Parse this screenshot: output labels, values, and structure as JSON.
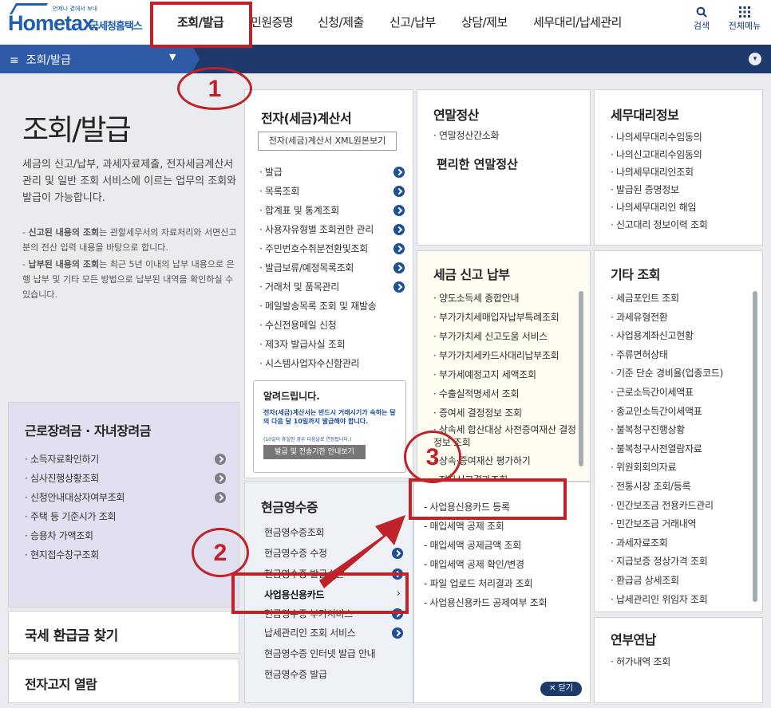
{
  "header": {
    "logo_text": "Hometax.",
    "logo_tagline": "국세청홈택스",
    "logo_small": "언제나 곁에서 보내",
    "nav": [
      "조회/발급",
      "민원증명",
      "신청/제출",
      "신고/납부",
      "상담/제보",
      "세무대리/납세관리"
    ],
    "search_label": "검색",
    "all_menu_label": "전체메뉴"
  },
  "subbar": {
    "menu_icon": "≡",
    "current": "조회/발급",
    "caret": "▼",
    "circle_icon": "▾"
  },
  "intro": {
    "title": "조회/발급",
    "description": "세금의 신고/납부, 과세자료제출, 전자세금계산서 관리 및 일반 조회 서비스에 이르는 업무의 조회와 발급이 가능합니다.",
    "note1_bold": "신고된 내용의 조회",
    "note1_rest": "는 관할세무서의 자료처리와 서면신고분의 전산 입력 내용을 바탕으로 합니다.",
    "note2_bold": "납부된 내용의 조회",
    "note2_rest": "는 최근 5년 이내의 납부 내용으로 은행 납부 및 기타 모든 방법으로 납부된 내역을 확인하실 수 있습니다."
  },
  "einvoice": {
    "title": "전자(세금)계산서",
    "xml_button": "전자(세금)계산서 XML원본보기",
    "items": [
      "발급",
      "목록조회",
      "합계표 및 통계조회",
      "사용자유형별 조회권한 관리",
      "주민번호수취분전환및조회",
      "발급보류/예정목록조회",
      "거래처 및 품목관리",
      "메일발송목록 조회 및 재발송",
      "수신전용메일 신청",
      "제3자 발급사실 조회",
      "시스템사업자수신함관리"
    ],
    "notice_title": "알려드립니다.",
    "notice_text": "전자(세금)계산서는 반드시 거래시기가 속하는 달의 다음 달 10일까지 발급해야 합니다.",
    "notice_small": "(10일이 휴일인 경우 다음날로 연장됩니다.)",
    "notice_button": "발급 및 전송기한 안내보기"
  },
  "yearend": {
    "title": "연말정산",
    "item": "연말정산간소화",
    "sub": "편리한 연말정산"
  },
  "agent": {
    "title": "세무대리정보",
    "items": [
      "나의세무대리수임동의",
      "나의신고대리수임동의",
      "나의세무대리인조회",
      "발급된 증명정보",
      "나의세무대리인 해임",
      "신고대리 정보이력 조회"
    ]
  },
  "tax_report": {
    "title": "세금 신고 납부",
    "items": [
      "양도소득세 종합안내",
      "부가가치세매입자납부특례조회",
      "부가가치세 신고도움 서비스",
      "부가가치세카드사대리납부조회",
      "부가세예정고지 세액조회",
      "수출실적명세서 조회",
      "증여세 결정정보 조회",
      "상속세 합산대상 사전증여재산 결정정보 조회",
      "상속·증여재산 평가하기",
      "전자신고결과조회"
    ]
  },
  "other": {
    "title": "기타 조회",
    "items": [
      "세금포인트 조회",
      "과세유형전환",
      "사업용계좌신고현황",
      "주류면허상태",
      "기준 단순 경비율(업종코드)",
      "근로소득간이세액표",
      "종교인소득간이세액표",
      "불복청구진행상황",
      "불복청구사전열람자료",
      "위원회회의자료",
      "전통시장 조회/등록",
      "민간보조금 전용카드관리",
      "민간보조금 거래내역",
      "과세자료조회",
      "지급보증 정상가격 조회",
      "환급금 상세조회",
      "납세관리인 위임자 조회"
    ]
  },
  "earned": {
    "title": "근로장려금 · 자녀장려금",
    "items": [
      "소득자료확인하기",
      "심사진행상황조회",
      "신청안내대상자여부조회",
      "주택 등 기준시가 조회",
      "승용차 가액조회",
      "현지접수창구조회"
    ]
  },
  "cash": {
    "title": "현금영수증",
    "items": [
      "현금영수증조회",
      "현금영수증 수정",
      "현금영수증 발급수단",
      "사업용신용카드",
      "현금영수증 부가서비스",
      "납세관리인 조회 서비스",
      "현금영수증 인터넷 발급 안내",
      "현금영수증 발급"
    ]
  },
  "biz_card": {
    "items": [
      "사업용신용카드 등록",
      "매입세액 공제 조회",
      "매입세액 공제금액 조회",
      "매입세액 공제 확인/변경",
      "파일 업로드 처리결과 조회",
      "사업용신용카드 공제여부 조회"
    ],
    "close": "닫기"
  },
  "refund": {
    "title": "국세 환급금 찾기"
  },
  "notice_view": {
    "title": "전자고지 열람"
  },
  "yeonbu": {
    "title": "연부연납",
    "item": "허가내역 조회"
  },
  "annotations": {
    "one": "1",
    "two": "2",
    "three": "3"
  }
}
